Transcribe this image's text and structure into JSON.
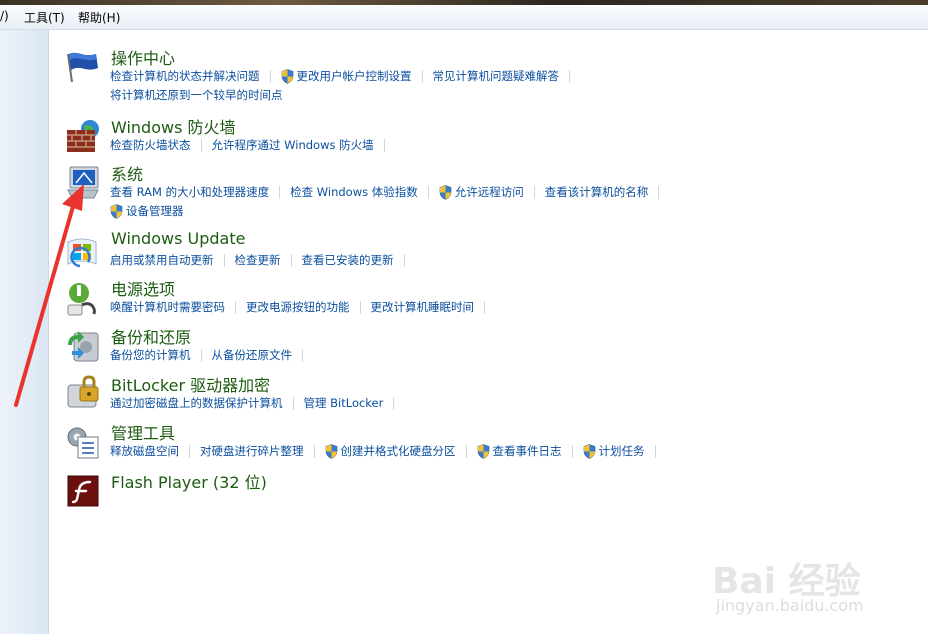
{
  "menu": {
    "partial_prefix": "/)",
    "tools": "工具(T)",
    "help": "帮助(H)"
  },
  "categories": [
    {
      "title": "操作中心",
      "icon": "flag-icon",
      "rows": [
        [
          {
            "label": "检查计算机的状态并解决问题",
            "shield": false
          },
          {
            "label": "更改用户帐户控制设置",
            "shield": true
          },
          {
            "label": "常见计算机问题疑难解答",
            "shield": false
          }
        ],
        [
          {
            "label": "将计算机还原到一个较早的时间点",
            "shield": false
          }
        ]
      ]
    },
    {
      "title": "Windows 防火墙",
      "icon": "firewall-icon",
      "rows": [
        [
          {
            "label": "检查防火墙状态",
            "shield": false
          },
          {
            "label": "允许程序通过 Windows 防火墙",
            "shield": false
          }
        ]
      ]
    },
    {
      "title": "系统",
      "icon": "computer-icon",
      "rows": [
        [
          {
            "label": "查看 RAM 的大小和处理器速度",
            "shield": false
          },
          {
            "label": "检查 Windows 体验指数",
            "shield": false
          },
          {
            "label": "允许远程访问",
            "shield": true
          },
          {
            "label": "查看该计算机的名称",
            "shield": false
          }
        ],
        [
          {
            "label": "设备管理器",
            "shield": true
          }
        ]
      ]
    },
    {
      "title": "Windows Update",
      "icon": "windows-update-icon",
      "rows": [
        [
          {
            "label": "启用或禁用自动更新",
            "shield": false
          },
          {
            "label": "检查更新",
            "shield": false
          },
          {
            "label": "查看已安装的更新",
            "shield": false
          }
        ]
      ]
    },
    {
      "title": "电源选项",
      "icon": "power-icon",
      "rows": [
        [
          {
            "label": "唤醒计算机时需要密码",
            "shield": false
          },
          {
            "label": "更改电源按钮的功能",
            "shield": false
          },
          {
            "label": "更改计算机睡眠时间",
            "shield": false
          }
        ]
      ]
    },
    {
      "title": "备份和还原",
      "icon": "backup-icon",
      "rows": [
        [
          {
            "label": "备份您的计算机",
            "shield": false
          },
          {
            "label": "从备份还原文件",
            "shield": false
          }
        ]
      ]
    },
    {
      "title": "BitLocker 驱动器加密",
      "icon": "bitlocker-icon",
      "rows": [
        [
          {
            "label": "通过加密磁盘上的数据保护计算机",
            "shield": false
          },
          {
            "label": "管理 BitLocker",
            "shield": false
          }
        ]
      ]
    },
    {
      "title": "管理工具",
      "icon": "admin-tools-icon",
      "rows": [
        [
          {
            "label": "释放磁盘空间",
            "shield": false
          },
          {
            "label": "对硬盘进行碎片整理",
            "shield": false
          },
          {
            "label": "创建并格式化硬盘分区",
            "shield": true
          },
          {
            "label": "查看事件日志",
            "shield": true
          },
          {
            "label": "计划任务",
            "shield": true
          }
        ]
      ]
    },
    {
      "title": "Flash Player (32 位)",
      "icon": "flash-icon",
      "rows": []
    }
  ],
  "watermark": {
    "brand": "Bai 经验",
    "url": "jingyan.baidu.com"
  },
  "colors": {
    "title_green": "#1e5b13",
    "link_blue": "#0b4f9e",
    "arrow_red": "#e8342c"
  }
}
